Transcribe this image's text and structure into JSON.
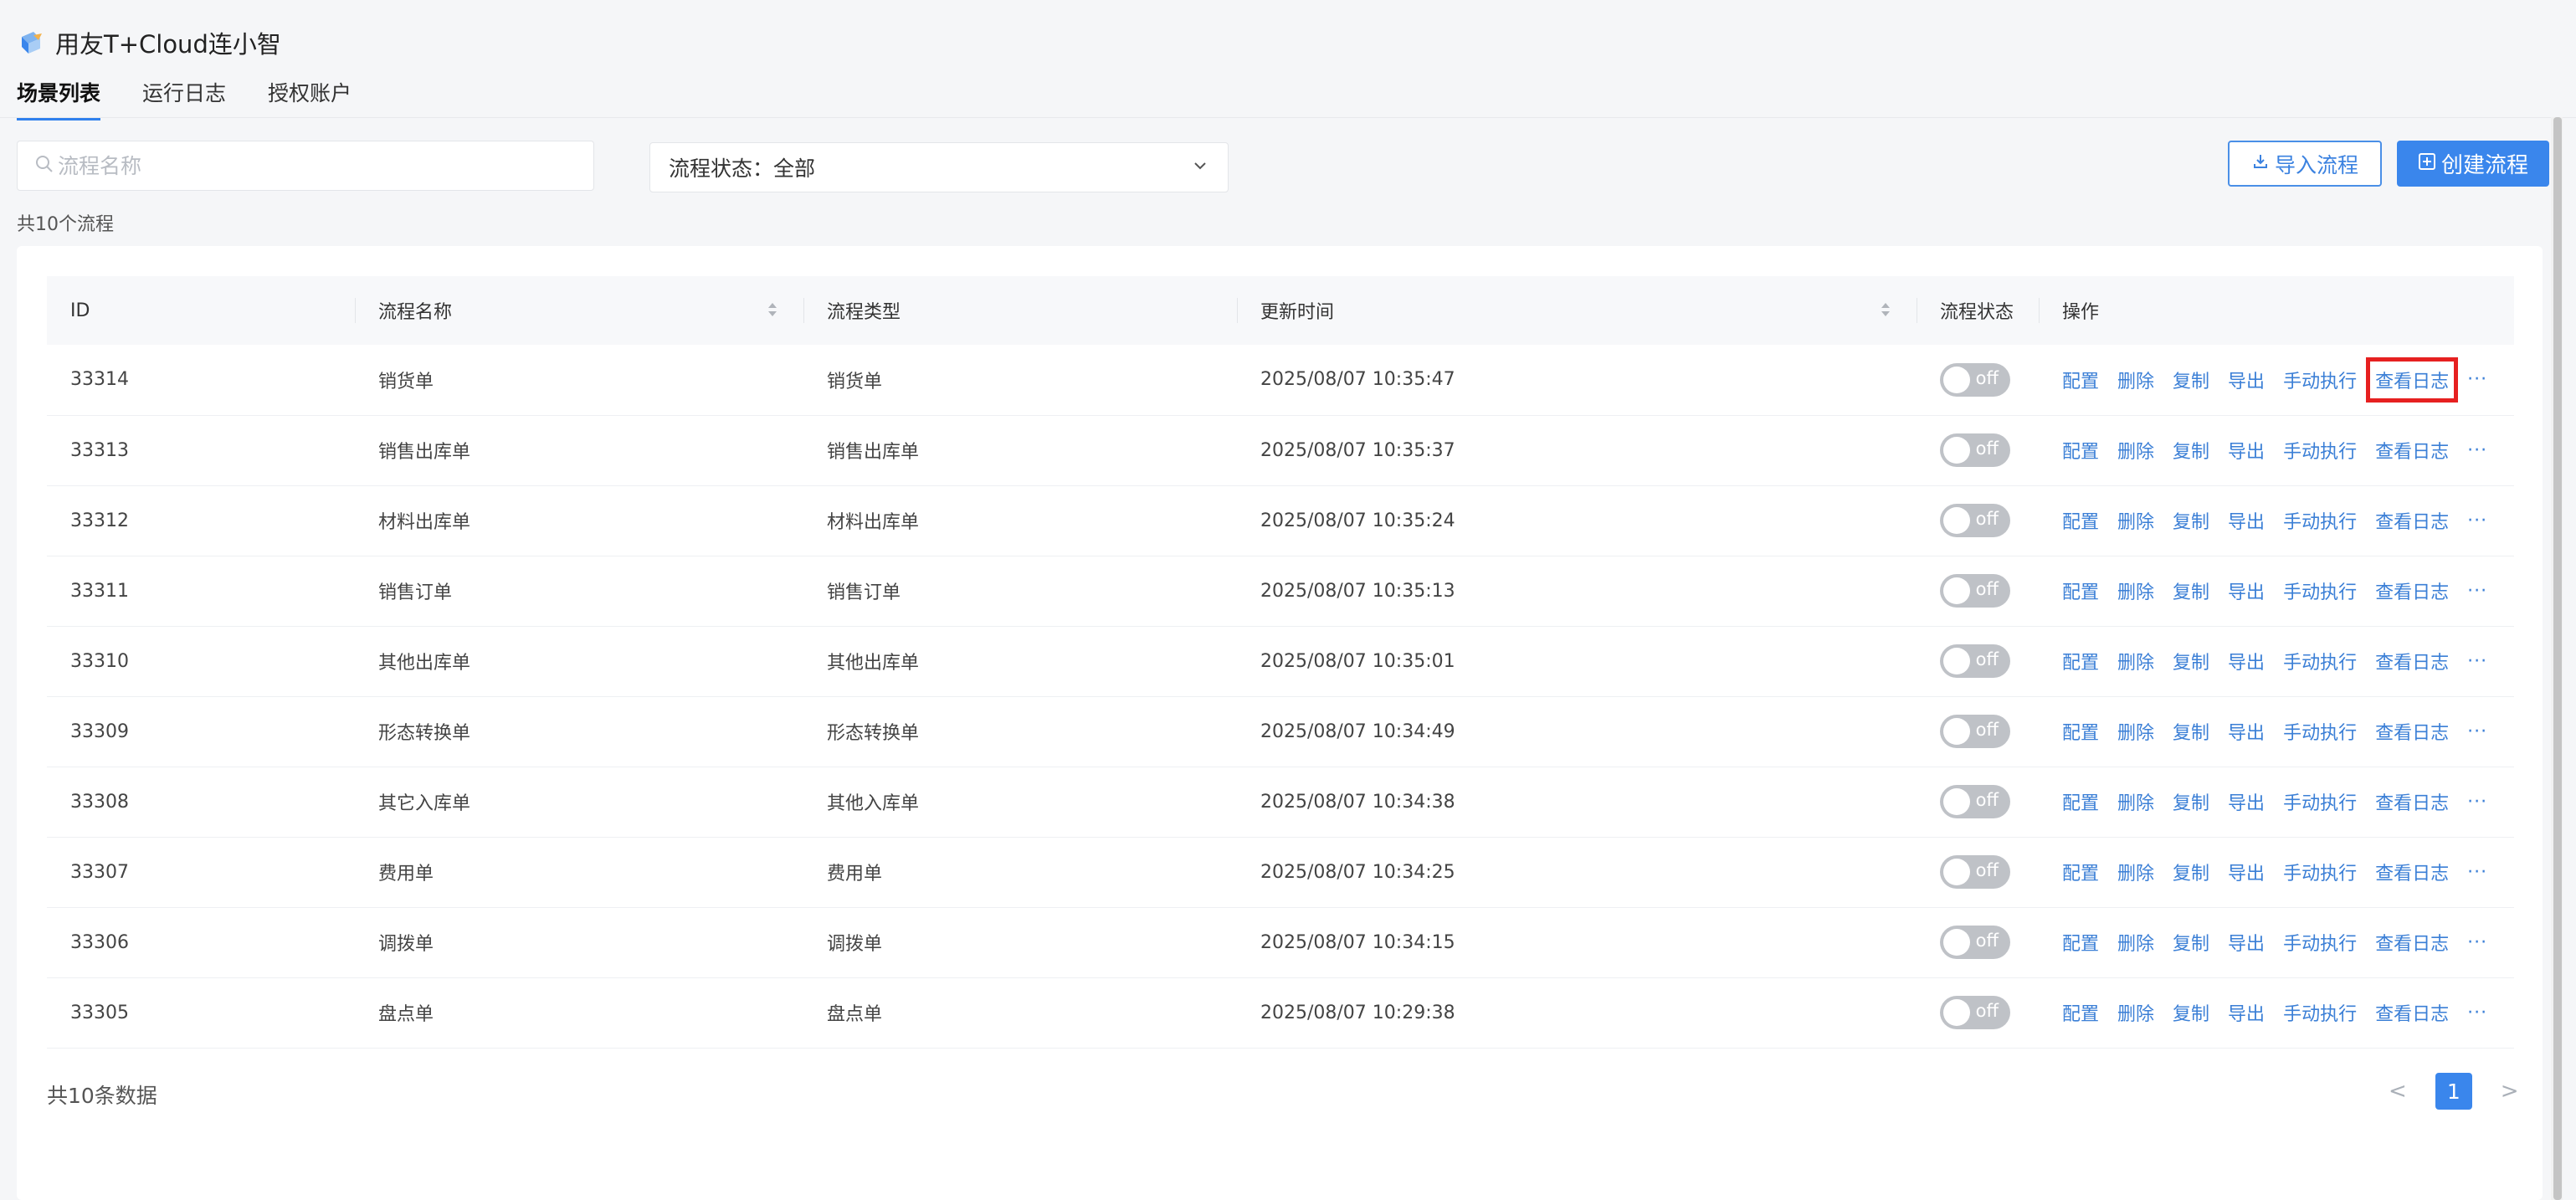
{
  "app": {
    "title": "用友T+Cloud连小智"
  },
  "tabs": [
    {
      "label": "场景列表",
      "active": true
    },
    {
      "label": "运行日志",
      "active": false
    },
    {
      "label": "授权账户",
      "active": false
    }
  ],
  "search": {
    "placeholder": "流程名称",
    "value": ""
  },
  "status_filter": {
    "label": "流程状态：全部"
  },
  "buttons": {
    "import": "导入流程",
    "create": "创建流程"
  },
  "flow_count": "共10个流程",
  "table": {
    "columns": [
      "ID",
      "流程名称",
      "流程类型",
      "更新时间",
      "流程状态",
      "操作"
    ],
    "actions": [
      "配置",
      "删除",
      "复制",
      "导出",
      "手动执行",
      "查看日志"
    ],
    "more": "···",
    "toggle_text": "off",
    "rows": [
      {
        "id": "33314",
        "name": "销货单",
        "type": "销货单",
        "updated": "2025/08/07 10:35:47",
        "status": "off"
      },
      {
        "id": "33313",
        "name": "销售出库单",
        "type": "销售出库单",
        "updated": "2025/08/07 10:35:37",
        "status": "off"
      },
      {
        "id": "33312",
        "name": "材料出库单",
        "type": "材料出库单",
        "updated": "2025/08/07 10:35:24",
        "status": "off"
      },
      {
        "id": "33311",
        "name": "销售订单",
        "type": "销售订单",
        "updated": "2025/08/07 10:35:13",
        "status": "off"
      },
      {
        "id": "33310",
        "name": "其他出库单",
        "type": "其他出库单",
        "updated": "2025/08/07 10:35:01",
        "status": "off"
      },
      {
        "id": "33309",
        "name": "形态转换单",
        "type": "形态转换单",
        "updated": "2025/08/07 10:34:49",
        "status": "off"
      },
      {
        "id": "33308",
        "name": "其它入库单",
        "type": "其他入库单",
        "updated": "2025/08/07 10:34:38",
        "status": "off"
      },
      {
        "id": "33307",
        "name": "费用单",
        "type": "费用单",
        "updated": "2025/08/07 10:34:25",
        "status": "off"
      },
      {
        "id": "33306",
        "name": "调拨单",
        "type": "调拨单",
        "updated": "2025/08/07 10:34:15",
        "status": "off"
      },
      {
        "id": "33305",
        "name": "盘点单",
        "type": "盘点单",
        "updated": "2025/08/07 10:29:38",
        "status": "off"
      }
    ]
  },
  "footer": {
    "total": "共10条数据",
    "current_page": "1",
    "prev": "<",
    "next": ">"
  },
  "colors": {
    "accent": "#3a86ec",
    "link": "#3b7fd6",
    "highlight": "#e62020",
    "toggle_off": "#bfc2c7"
  }
}
